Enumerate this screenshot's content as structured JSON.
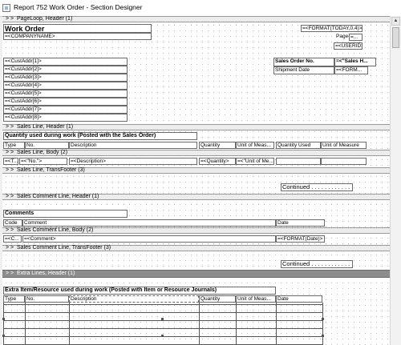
{
  "window": {
    "title": "Report 752 Work Order - Section Designer"
  },
  "sections": {
    "s1": "PageLoop, Header (1)",
    "s2": "Sales Line, Header (1)",
    "s3": "Sales Line, Body (2)",
    "s4": "Sales Line, TransFooter (3)",
    "s5": "Sales Comment Line, Header (1)",
    "s6": "Sales Comment Line, Body (2)",
    "s7": "Sales Comment Line, TransFooter (3)",
    "s8": "Extra Lines, Header (1)",
    "arrows": "> >"
  },
  "header": {
    "title": "Work Order",
    "company": "=<COMPANYNAME>",
    "format_today": "=<FORMAT(TODAY,0,4)>",
    "page_label": "Page",
    "page_value": "=...",
    "userid": "=<USERID>",
    "cust_addr": [
      "=<CustAddr[1]>",
      "=<CustAddr[2]>",
      "=<CustAddr[3]>",
      "=<CustAddr[4]>",
      "=<CustAddr[5]>",
      "=<CustAddr[6]>",
      "=<CustAddr[7]>",
      "=<CustAddr[8]>"
    ],
    "sales_order_label": "Sales Order No.",
    "sales_order_value": "=<\"Sales H...",
    "shipment_label": "Shipment Date",
    "shipment_value": "=<FORM..."
  },
  "sales_line_header": {
    "caption": "Quantity used during work (Posted with the Sales Order)",
    "columns": [
      "Type",
      "No.",
      "Description",
      "Quantity",
      "Unit of Meas...",
      "Quantity Used",
      "Unit of Measure"
    ]
  },
  "sales_line_body": {
    "fields": [
      "=<T...",
      "=<\"No.\">",
      "=<Description>",
      "=<Quantity>",
      "=<\"Unit of Me..."
    ]
  },
  "transfooter": {
    "continued": "Continued . . . . . . . . . . . ."
  },
  "comments": {
    "caption": "Comments",
    "columns": [
      "Code",
      "Comment",
      "Date"
    ],
    "fields": [
      "=<C...",
      "=<Comment>",
      "=<FORMAT(Date)>"
    ],
    "continued": "Continued . . . . . . . . . . . ."
  },
  "extra": {
    "caption": "Extra Item/Resource used during work (Posted with Item or Resource Journals)",
    "columns": [
      "Type",
      "No.",
      "Description",
      "Quantity",
      "Unit of Meas...",
      "Date"
    ]
  }
}
